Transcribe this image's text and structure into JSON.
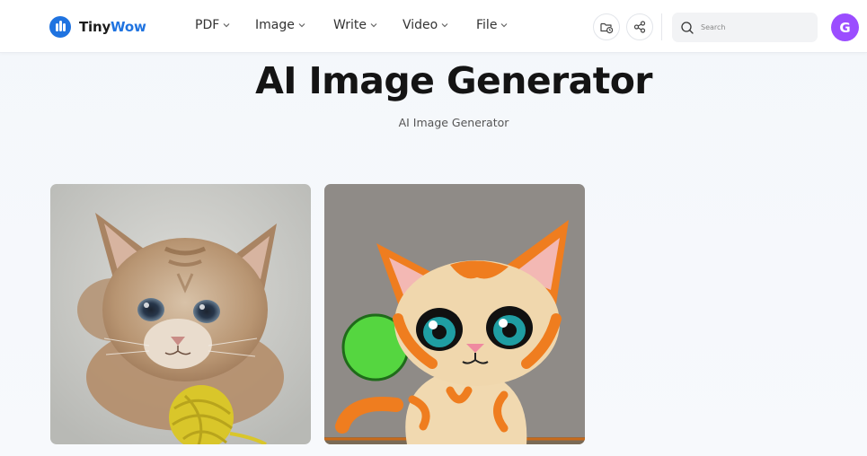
{
  "brand": {
    "name_part1": "Tiny",
    "name_part2": "Wow",
    "accent": "#1f73e0"
  },
  "nav": {
    "items": [
      {
        "label": "PDF"
      },
      {
        "label": "Image"
      },
      {
        "label": "Write"
      },
      {
        "label": "Video"
      },
      {
        "label": "File"
      }
    ]
  },
  "header_actions": {
    "files_icon": "folder-clock-icon",
    "share_icon": "share-icon",
    "search_placeholder": "Search",
    "avatar_initial": "G",
    "avatar_color": "#9b4dff"
  },
  "page": {
    "title": "AI Image Generator",
    "subtitle": "AI Image Generator"
  },
  "results": [
    {
      "name": "generated-image-photo-kitten"
    },
    {
      "name": "generated-image-painted-kitten"
    }
  ]
}
